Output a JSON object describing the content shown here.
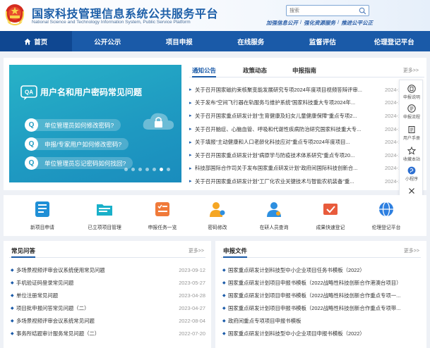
{
  "header": {
    "title": "国家科技管理信息系统公共服务平台",
    "subtitle": "National Science and Technology Information System, Public Service Platform",
    "search_placeholder": "搜索",
    "slogans": [
      "加强信息公开",
      "强化资源服务",
      "推进公平公正"
    ]
  },
  "nav": {
    "items": [
      {
        "label": "首页"
      },
      {
        "label": "公开公示"
      },
      {
        "label": "项目申报"
      },
      {
        "label": "在线服务"
      },
      {
        "label": "监督评估"
      },
      {
        "label": "伦理登记平台"
      }
    ]
  },
  "carousel": {
    "heading": "用户名和用户密码常见问题",
    "questions": [
      "单位管理员如何修改密码?",
      "申报/专家用户如何修改密码?",
      "单位管理员忘记密码如何找回?"
    ]
  },
  "news": {
    "tabs": [
      "通知公告",
      "政策动态",
      "申报指南"
    ],
    "more": "更多>>",
    "items": [
      {
        "text": "关于召开国家磁约束核聚变能发展研究专项2024年度项目视频答辩评审...",
        "date": "2024-1"
      },
      {
        "text": "关于发布“空间飞行器在轨服务与维护系统”国家科技重大专项2024年...",
        "date": "2024-1"
      },
      {
        "text": "关于召开国家重点研发计划“生育健康及妇女儿童健康保障”重点专项2...",
        "date": "2024-1"
      },
      {
        "text": "关于召开脑症、心脑血管、呼吸和代谢性疾病防治研究国家科技重大专...",
        "date": "2024-1"
      },
      {
        "text": "关于填报“主动健康和人口老龄化科技应对”重点专项2024年度项目...",
        "date": "2024-1"
      },
      {
        "text": "关于召开国家重点研发计划“病原学与防疫技术体系研究”重点专项20...",
        "date": "2024-1"
      },
      {
        "text": "科技部国际合作司关于发布国家重点研发计划“政府间国际科技创新合...",
        "date": "2024-1"
      },
      {
        "text": "关于召开国家重点研发计划“工厂化农业关键技术与智能农机装备”重...",
        "date": "2024-1"
      }
    ]
  },
  "side_toolbar": {
    "items": [
      {
        "label": "申报说明",
        "icon": "doc-icon"
      },
      {
        "label": "申报流程",
        "icon": "flow-icon"
      },
      {
        "label": "用户手册",
        "icon": "book-icon"
      },
      {
        "label": "收藏本站",
        "icon": "star-icon"
      },
      {
        "label": "小程序",
        "icon": "miniapp-icon"
      },
      {
        "label": "关闭",
        "icon": "close-icon"
      }
    ]
  },
  "quick_links": [
    {
      "label": "新项目申请",
      "color": "#1f8fd6"
    },
    {
      "label": "已立项项目管理",
      "color": "#19b0c9"
    },
    {
      "label": "申报任务一览",
      "color": "#f07a3a"
    },
    {
      "label": "密码修改",
      "color": "#f5a623"
    },
    {
      "label": "在研人员查询",
      "color": "#2d8fe0"
    },
    {
      "label": "成果快速登记",
      "color": "#e85b3c"
    },
    {
      "label": "伦理登记平台",
      "color": "#2d7fe0"
    }
  ],
  "faq": {
    "title": "常见问答",
    "more": "更多>>",
    "items": [
      {
        "text": "多场景视频评审会议系统使用常见问题",
        "date": "2023-09-12"
      },
      {
        "text": "手机验证码登录常见问题",
        "date": "2023-05-27"
      },
      {
        "text": "单位注册常见问题",
        "date": "2023-04-28"
      },
      {
        "text": "项目批申报问答常见问题（二）",
        "date": "2023-04-27"
      },
      {
        "text": "多场景视频评审会议系统常见问题",
        "date": "2022-08-04"
      },
      {
        "text": "事务所结题审计服务常见问题（二）",
        "date": "2022-07-20"
      }
    ]
  },
  "docs": {
    "title": "申报文件",
    "more": "更多>>",
    "items": [
      {
        "text": "国家重点研发计划科技型中小企业项目任务书模板（2022）"
      },
      {
        "text": "国家重点研发计划项目申报书模板（2022战略性科技创新合作港澳台项目）"
      },
      {
        "text": "国家重点研发计划项目申报书模板（2022战略性科技创新合作重点专项一..."
      },
      {
        "text": "国家重点研发计划项目申报书模板（2022战略性科技创新合作重点专项带..."
      },
      {
        "text": "政府间重点专项项目申报书模板"
      },
      {
        "text": "国家重点研发计划科技型中小企业项目申报书模板（2022）"
      }
    ]
  }
}
